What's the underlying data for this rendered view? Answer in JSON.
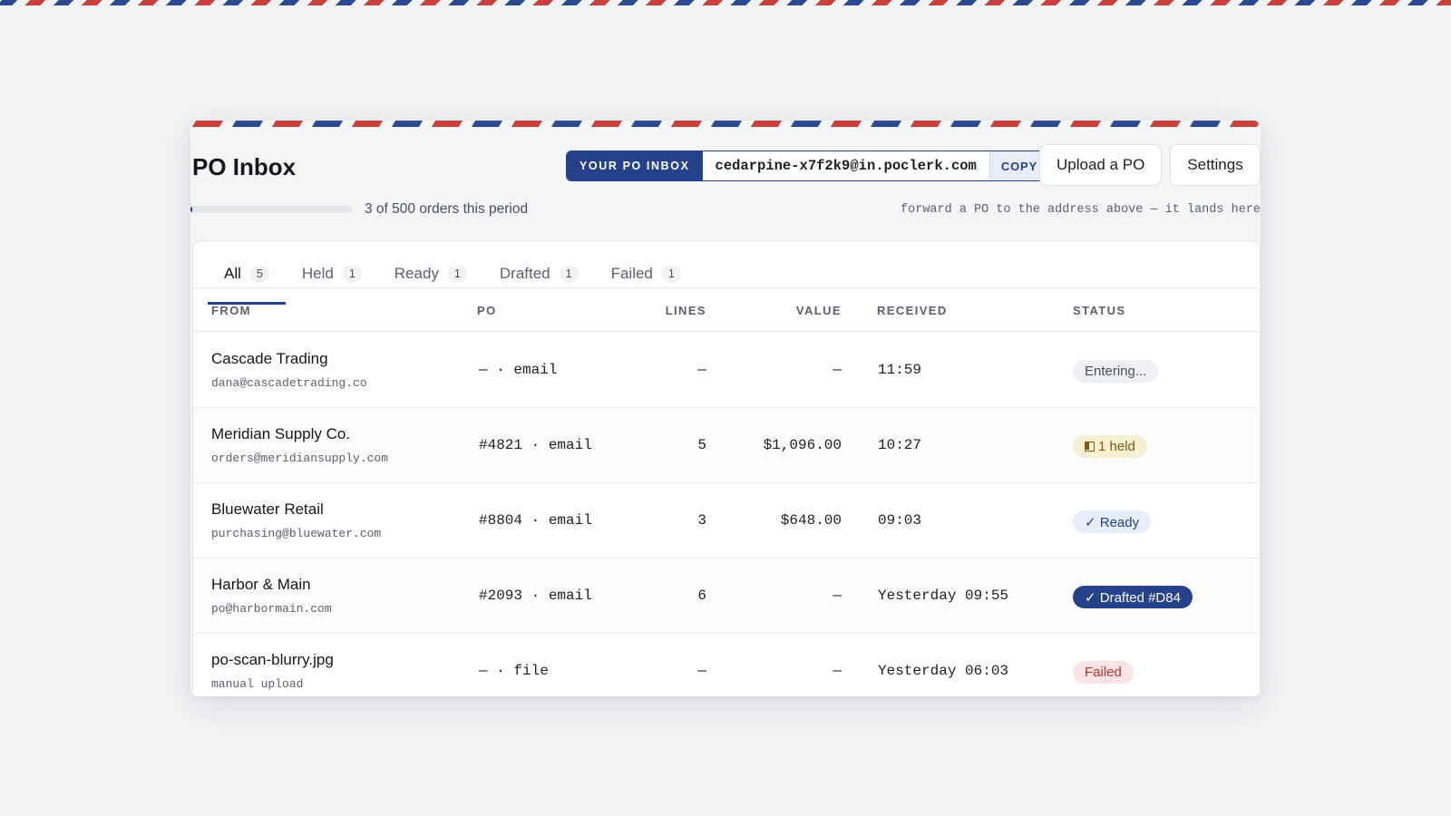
{
  "header": {
    "title": "PO Inbox",
    "inbox_tag": "YOUR PO INBOX",
    "inbox_address": "cedarpine-x7f2k9@in.poclerk.com",
    "copy_label": "COPY",
    "upload_label": "Upload a PO",
    "settings_label": "Settings"
  },
  "usage": {
    "text": "3 of 500 orders this period",
    "used": 3,
    "limit": 500,
    "hint": "forward a PO to the address above — it lands here"
  },
  "tabs": [
    {
      "label": "All",
      "count": "5"
    },
    {
      "label": "Held",
      "count": "1"
    },
    {
      "label": "Ready",
      "count": "1"
    },
    {
      "label": "Drafted",
      "count": "1"
    },
    {
      "label": "Failed",
      "count": "1"
    }
  ],
  "columns": {
    "from": "FROM",
    "po": "PO",
    "lines": "LINES",
    "value": "VALUE",
    "received": "RECEIVED",
    "status": "STATUS"
  },
  "rows": [
    {
      "name": "Cascade Trading",
      "email": "dana@cascadetrading.co",
      "po": "— · email",
      "lines": "—",
      "value": "—",
      "received": "11:59",
      "status": "Entering..."
    },
    {
      "name": "Meridian Supply Co.",
      "email": "orders@meridiansupply.com",
      "po": "#4821 · email",
      "lines": "5",
      "value": "$1,096.00",
      "received": "10:27",
      "status": "1 held"
    },
    {
      "name": "Bluewater Retail",
      "email": "purchasing@bluewater.com",
      "po": "#8804 · email",
      "lines": "3",
      "value": "$648.00",
      "received": "09:03",
      "status": "✓ Ready"
    },
    {
      "name": "Harbor & Main",
      "email": "po@harbormain.com",
      "po": "#2093 · email",
      "lines": "6",
      "value": "—",
      "received": "Yesterday 09:55",
      "status": "✓ Drafted #D84"
    },
    {
      "name": "po-scan-blurry.jpg",
      "email": "manual upload",
      "po": "— · file",
      "lines": "—",
      "value": "—",
      "received": "Yesterday 06:03",
      "status": "Failed"
    }
  ],
  "colors": {
    "accent": "#24418a",
    "airmail_red": "#c8413d",
    "airmail_blue": "#2c4a8f",
    "held": "#f8f0d3",
    "failed": "#fbe4e3"
  }
}
